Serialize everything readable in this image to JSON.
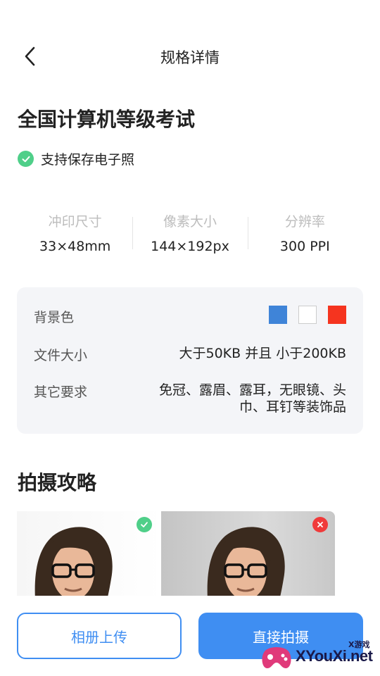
{
  "header": {
    "title": "规格详情",
    "back_icon": "chevron-left-icon"
  },
  "spec": {
    "title": "全国计算机等级考试",
    "support_text": "支持保存电子照"
  },
  "stats": [
    {
      "label": "冲印尺寸",
      "value": "33×48mm"
    },
    {
      "label": "像素大小",
      "value": "144×192px"
    },
    {
      "label": "分辨率",
      "value": "300 PPI"
    }
  ],
  "info": {
    "background_label": "背景色",
    "background_colors": [
      "#3f84d8",
      "#ffffff",
      "#f5341f"
    ],
    "filesize_label": "文件大小",
    "filesize_value": "大于50KB 并且 小于200KB",
    "other_label": "其它要求",
    "other_value_line1": "免冠、露眉、露耳，无眼镜、头",
    "other_value_line2": "巾、耳钉等装饰品"
  },
  "guide": {
    "title": "拍摄攻略",
    "good_icon": "check-badge-icon",
    "bad_icon": "cross-badge-icon"
  },
  "actions": {
    "upload_label": "相册上传",
    "shoot_label": "直接拍摄"
  },
  "watermark": {
    "text": "XYouXi.net",
    "small_text": "X游戏"
  }
}
